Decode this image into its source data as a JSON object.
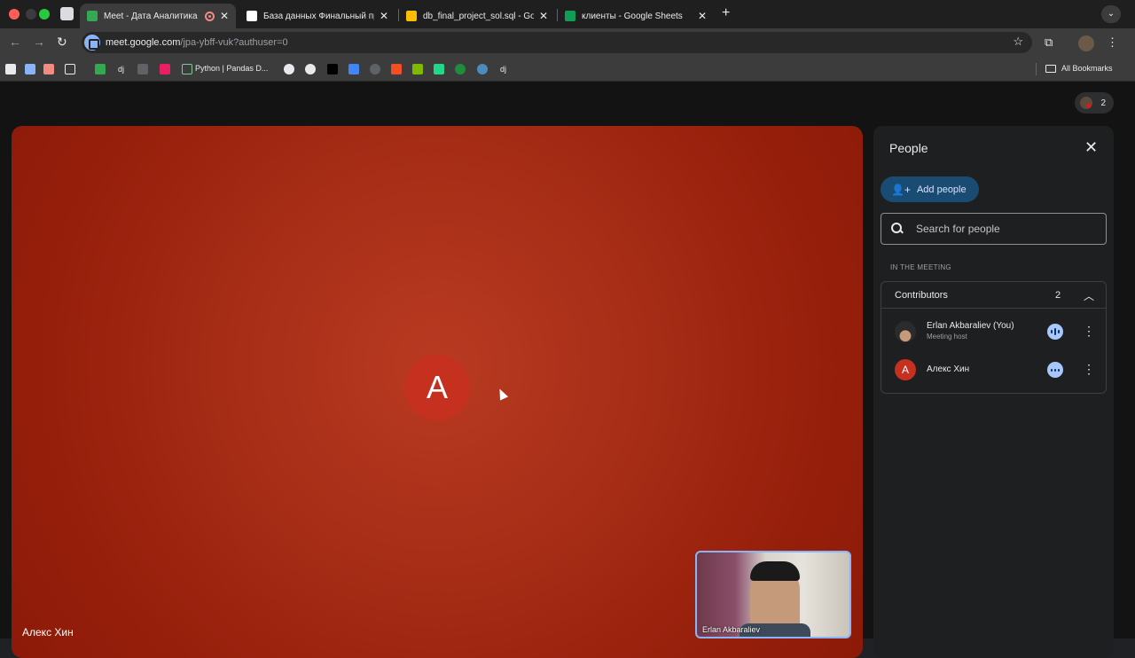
{
  "tabs": [
    {
      "title": "Meet - Дата Аналитика",
      "favicon_color": "#34a853",
      "recording": true
    },
    {
      "title": "База данных Финальный пр",
      "favicon_color": "#ffffff",
      "recording": false
    },
    {
      "title": "db_final_project_sol.sql - Go",
      "favicon_color": "#fbbc04",
      "recording": false
    },
    {
      "title": "клиенты - Google Sheets",
      "favicon_color": "#0f9d58",
      "recording": false
    }
  ],
  "address_bar": {
    "host": "meet.google.com",
    "path": "/jpa-ybff-vuk?authuser=0"
  },
  "bookmarks": {
    "python_pandas": "Python | Pandas D...",
    "dj1": "dj",
    "dj2": "dj",
    "all_bookmarks": "All Bookmarks"
  },
  "meeting": {
    "participant_count": "2",
    "main_tile": {
      "avatar_letter": "A",
      "name": "Алекс Хин",
      "color": "#c5301f"
    },
    "self_view": {
      "name": "Erlan Akbaraliev"
    }
  },
  "people_panel": {
    "title": "People",
    "add_people_label": "Add people",
    "search_placeholder": "Search for people",
    "section_label": "IN THE MEETING",
    "group": {
      "title": "Contributors",
      "count": "2"
    },
    "people": [
      {
        "name": "Erlan Akbaraliev (You)",
        "role": "Meeting host",
        "avatar": "photo"
      },
      {
        "name": "Алекс Хин",
        "role": "",
        "avatar_letter": "A"
      }
    ]
  },
  "icons": [
    "back-arrow-icon",
    "forward-arrow-icon",
    "reload-icon",
    "bookmark-star-icon",
    "extensions-icon",
    "kebab-menu-icon",
    "close-icon",
    "add-person-icon",
    "search-icon",
    "chevron-up-icon",
    "audio-indicator-icon",
    "more-vert-icon"
  ]
}
